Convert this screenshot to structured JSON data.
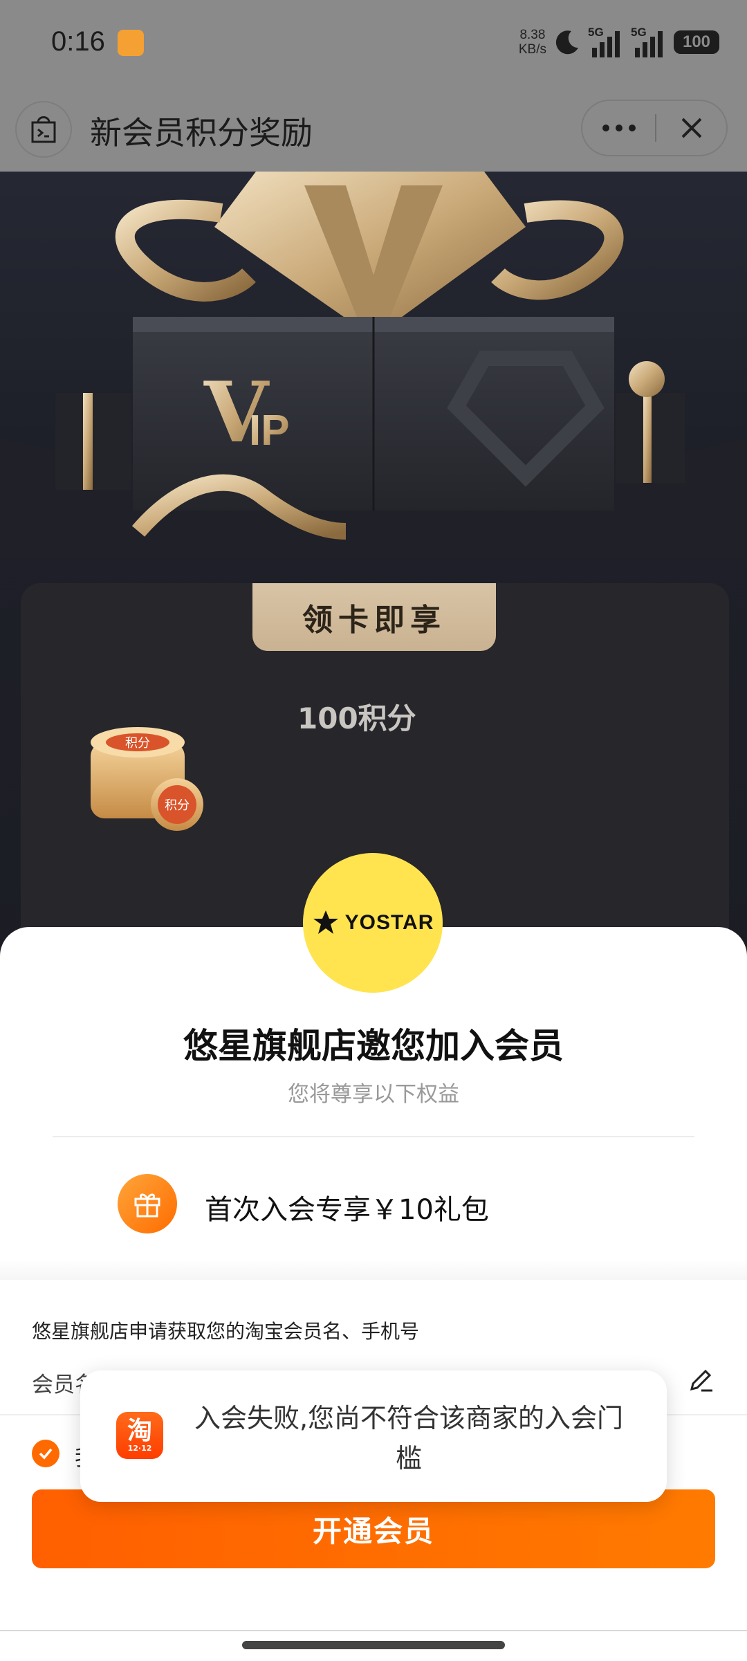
{
  "status_bar": {
    "time": "0:16",
    "net_speed_value": "8.38",
    "net_speed_unit": "KB/s",
    "signal_1_label": "5G",
    "signal_2_label": "5G",
    "battery": "100"
  },
  "header": {
    "title": "新会员积分奖励"
  },
  "promo": {
    "vip_text": "IP",
    "card_ribbon": "领卡即享",
    "points": "100积分",
    "coin_label": "积分"
  },
  "sheet": {
    "brand_logo_text": "YOSTAR",
    "title": "悠星旗舰店邀您加入会员",
    "subtitle": "您将尊享以下权益",
    "benefit": "首次入会专享￥10礼包",
    "auth_request": "悠星旗舰店申请获取您的淘宝会员名、手机号",
    "member_name_label": "会员名",
    "agree_char": "我",
    "join_button": "开通会员"
  },
  "toast": {
    "message": "入会失败,您尚不符合该商家的入会门槛",
    "app_icon_char": "淘",
    "app_icon_sub": "12·12"
  },
  "colors": {
    "accent_orange": "#ff6a00",
    "logo_yellow": "#ffe44f",
    "ribbon_gold": "#d8c4a6"
  }
}
